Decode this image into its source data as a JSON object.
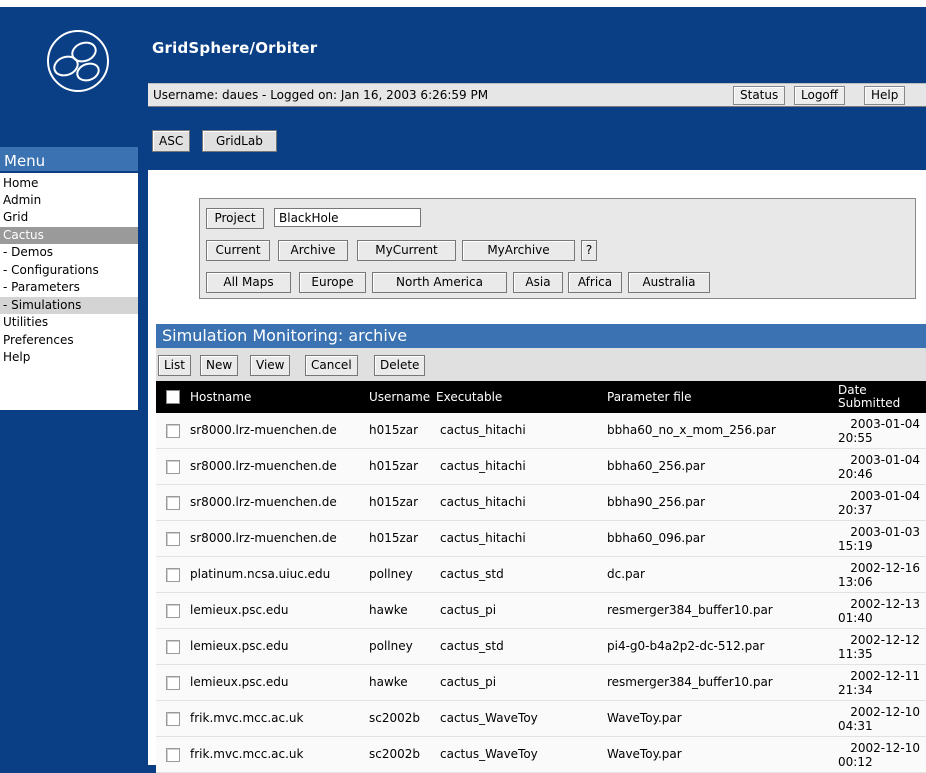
{
  "app": {
    "title": "GridSphere/Orbiter"
  },
  "userbar": {
    "info": "Username: daues -  Logged on: Jan 16, 2003 6:26:59 PM",
    "status_label": "Status",
    "logoff_label": "Logoff",
    "help_label": "Help"
  },
  "tabs": [
    {
      "label": "ASC"
    },
    {
      "label": "GridLab"
    }
  ],
  "menu": {
    "title": "Menu",
    "items": [
      {
        "label": "Home"
      },
      {
        "label": "Admin"
      },
      {
        "label": "Grid"
      },
      {
        "label": "Cactus",
        "selected": true
      },
      {
        "label": "-  Demos"
      },
      {
        "label": "-  Configurations"
      },
      {
        "label": "-  Parameters"
      },
      {
        "label": "-  Simulations",
        "selected": true
      },
      {
        "label": "Utilities"
      },
      {
        "label": "Preferences"
      },
      {
        "label": "Help"
      }
    ]
  },
  "filter": {
    "project_label": "Project",
    "project_value": "BlackHole",
    "current_label": "Current",
    "archive_label": "Archive",
    "mycurrent_label": "MyCurrent",
    "myarchive_label": "MyArchive",
    "help_label": "?",
    "maps": [
      {
        "label": "All Maps"
      },
      {
        "label": "Europe"
      },
      {
        "label": "North America"
      },
      {
        "label": "Asia"
      },
      {
        "label": "Africa"
      },
      {
        "label": "Australia"
      }
    ]
  },
  "simulation": {
    "title": "Simulation Monitoring: archive",
    "toolbar": {
      "list_label": "List",
      "new_label": "New",
      "view_label": "View",
      "cancel_label": "Cancel",
      "delete_label": "Delete"
    },
    "columns": {
      "hostname": "Hostname",
      "username": "Username",
      "executable": "Executable",
      "parameter_file": "Parameter file",
      "date_line1": "Date",
      "date_line2": "Submitted"
    },
    "rows": [
      {
        "hostname": "sr8000.lrz-muenchen.de",
        "username": "h015zar",
        "executable": "cactus_hitachi",
        "parameter_file": "bbha60_no_x_mom_256.par",
        "date": "2003-01-04",
        "time": "20:55"
      },
      {
        "hostname": "sr8000.lrz-muenchen.de",
        "username": "h015zar",
        "executable": "cactus_hitachi",
        "parameter_file": "bbha60_256.par",
        "date": "2003-01-04",
        "time": "20:46"
      },
      {
        "hostname": "sr8000.lrz-muenchen.de",
        "username": "h015zar",
        "executable": "cactus_hitachi",
        "parameter_file": "bbha90_256.par",
        "date": "2003-01-04",
        "time": "20:37"
      },
      {
        "hostname": "sr8000.lrz-muenchen.de",
        "username": "h015zar",
        "executable": "cactus_hitachi",
        "parameter_file": "bbha60_096.par",
        "date": "2003-01-03",
        "time": "15:19"
      },
      {
        "hostname": "platinum.ncsa.uiuc.edu",
        "username": "pollney",
        "executable": "cactus_std",
        "parameter_file": "dc.par",
        "date": "2002-12-16",
        "time": "13:06"
      },
      {
        "hostname": "lemieux.psc.edu",
        "username": "hawke",
        "executable": "cactus_pi",
        "parameter_file": "resmerger384_buffer10.par",
        "date": "2002-12-13",
        "time": "01:40"
      },
      {
        "hostname": "lemieux.psc.edu",
        "username": "pollney",
        "executable": "cactus_std",
        "parameter_file": "pi4-g0-b4a2p2-dc-512.par",
        "date": "2002-12-12",
        "time": "11:35"
      },
      {
        "hostname": "lemieux.psc.edu",
        "username": "hawke",
        "executable": "cactus_pi",
        "parameter_file": "resmerger384_buffer10.par",
        "date": "2002-12-11",
        "time": "21:34"
      },
      {
        "hostname": "frik.mvc.mcc.ac.uk",
        "username": "sc2002b",
        "executable": "cactus_WaveToy",
        "parameter_file": "WaveToy.par",
        "date": "2002-12-10",
        "time": "04:31"
      },
      {
        "hostname": "frik.mvc.mcc.ac.uk",
        "username": "sc2002b",
        "executable": "cactus_WaveToy",
        "parameter_file": "WaveToy.par",
        "date": "2002-12-10",
        "time": "00:12"
      }
    ]
  }
}
